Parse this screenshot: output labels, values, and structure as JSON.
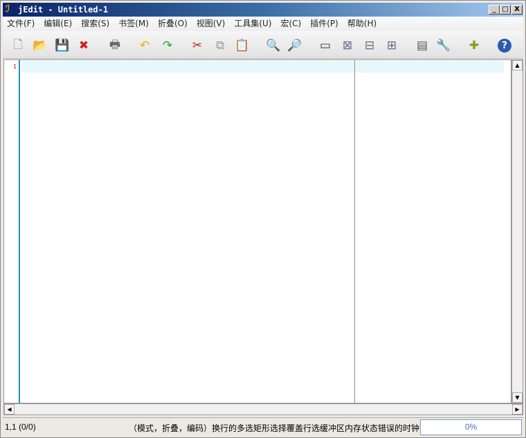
{
  "window": {
    "title": "jEdit - Untitled-1",
    "logo": "JE",
    "minimize": "_",
    "maximize": "□",
    "close": "X"
  },
  "menu": [
    "文件(F)",
    "编辑(E)",
    "搜索(S)",
    "书签(M)",
    "折叠(O)",
    "视图(V)",
    "工具集(U)",
    "宏(C)",
    "插件(P)",
    "帮助(H)"
  ],
  "toolbar": [
    {
      "name": "new-file-icon",
      "glyph": "🗋",
      "color": "#888"
    },
    {
      "name": "open-folder-icon",
      "glyph": "📂",
      "color": "#3a70c0"
    },
    {
      "name": "save-icon",
      "glyph": "💾",
      "color": "#2a7ab0"
    },
    {
      "name": "close-file-icon",
      "glyph": "✖",
      "color": "#d02020"
    },
    {
      "name": "print-icon",
      "glyph": "🖶",
      "color": "#666"
    },
    {
      "name": "undo-icon",
      "glyph": "↶",
      "color": "#e0b000"
    },
    {
      "name": "redo-icon",
      "glyph": "↷",
      "color": "#30a030"
    },
    {
      "name": "cut-icon",
      "glyph": "✂",
      "color": "#c02020"
    },
    {
      "name": "copy-icon",
      "glyph": "⧉",
      "color": "#999"
    },
    {
      "name": "paste-icon",
      "glyph": "📋",
      "color": "#a06020"
    },
    {
      "name": "find-icon",
      "glyph": "🔍",
      "color": "#4080c0"
    },
    {
      "name": "find-next-icon",
      "glyph": "🔎",
      "color": "#40a040"
    },
    {
      "name": "new-view-icon",
      "glyph": "▭",
      "color": "#335"
    },
    {
      "name": "unsplit-icon",
      "glyph": "⊠",
      "color": "#668"
    },
    {
      "name": "split-horizontal-icon",
      "glyph": "⊟",
      "color": "#668"
    },
    {
      "name": "split-vertical-icon",
      "glyph": "⊞",
      "color": "#668"
    },
    {
      "name": "buffer-options-icon",
      "glyph": "▤",
      "color": "#555"
    },
    {
      "name": "global-options-icon",
      "glyph": "🔧",
      "color": "#2060a0"
    },
    {
      "name": "plugin-manager-icon",
      "glyph": "✚",
      "color": "#80a020"
    },
    {
      "name": "help-icon",
      "glyph": "?",
      "color": "#2050a0"
    }
  ],
  "editor": {
    "line_numbers": [
      "1"
    ]
  },
  "status": {
    "caret": "1,1 (0/0)",
    "modes": "（模式，折叠，编码）换行的多选矩形选择覆盖行选缓冲区内存状态错误的时钟",
    "memory": "0%"
  }
}
